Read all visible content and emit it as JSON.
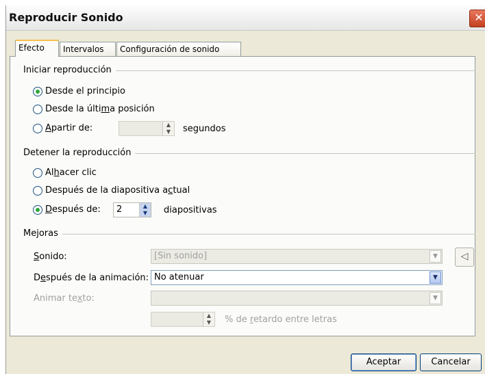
{
  "window": {
    "title": "Reproducir Sonido",
    "close_glyph": "✕"
  },
  "tabs": [
    {
      "label": "Efecto"
    },
    {
      "label": "Intervalos"
    },
    {
      "label": "Configuración de sonido"
    }
  ],
  "start": {
    "group_label": "Iniciar reproducción",
    "options": [
      {
        "label": "Desde el principio",
        "selected": true
      },
      {
        "label_before": "Desde la últi",
        "label_ul": "m",
        "label_after": "a posición",
        "selected": false
      },
      {
        "label_ul": "A",
        "label_after": " partir de:",
        "selected": false
      }
    ],
    "seconds_unit": "segundos"
  },
  "stop": {
    "group_label": "Detener la reproducción",
    "options": [
      {
        "label_before": "Al ",
        "label_ul": "h",
        "label_after": "acer clic",
        "selected": false
      },
      {
        "label_before": "Después de la diapositiva a",
        "label_ul": "c",
        "label_after": "tual",
        "selected": false
      },
      {
        "label_before": "",
        "label_ul": "D",
        "label_after": "espués de:",
        "selected": true
      }
    ],
    "slides_value": "2",
    "slides_unit": "diapositivas"
  },
  "enhancements": {
    "group_label": "Mejoras",
    "sound_label_ul": "S",
    "sound_label_after": "onido:",
    "sound_value": "[Sin sonido]",
    "after_anim_label_before": "D",
    "after_anim_label_ul": "e",
    "after_anim_label_after": "spués de la animación:",
    "after_anim_value": "No atenuar",
    "animate_text_label_before": "Animar te",
    "animate_text_label_ul": "x",
    "animate_text_label_after": "to:",
    "animate_text_value": "",
    "delay_label_before": "% de ",
    "delay_label_ul": "r",
    "delay_label_after": "etardo entre letras"
  },
  "buttons": {
    "ok": "Aceptar",
    "cancel": "Cancelar"
  },
  "icons": {
    "speaker": "speaker-icon",
    "dropdown": "chevron-down-icon"
  }
}
